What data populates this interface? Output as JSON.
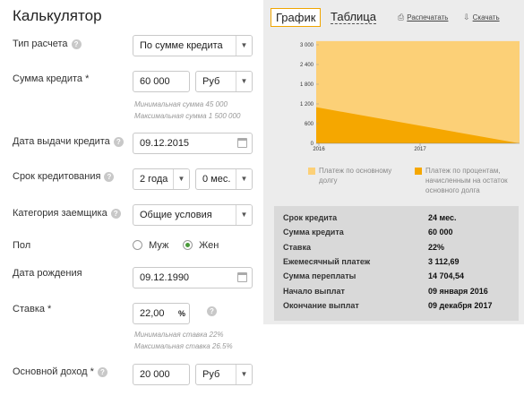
{
  "title": "Калькулятор",
  "form": {
    "loan_type": {
      "label": "Тип расчета",
      "value": "По сумме кредита"
    },
    "amount": {
      "label": "Сумма кредита *",
      "value": "60 000",
      "currency": "Руб",
      "hint_min": "Минимальная сумма 45 000",
      "hint_max": "Максимальная сумма 1 500 000"
    },
    "issue_date": {
      "label": "Дата выдачи кредита",
      "value": "09.12.2015"
    },
    "term": {
      "label": "Срок кредитования",
      "years": "2 года",
      "months": "0 мес."
    },
    "category": {
      "label": "Категория заемщика",
      "value": "Общие условия"
    },
    "gender": {
      "label": "Пол",
      "male": "Муж",
      "female": "Жен",
      "selected": "female"
    },
    "birth_date": {
      "label": "Дата рождения",
      "value": "09.12.1990"
    },
    "rate": {
      "label": "Ставка *",
      "value": "22,00",
      "unit": "%",
      "hint_min": "Минимальная ставка 22%",
      "hint_max": "Максимальная ставка 26.5%"
    },
    "income": {
      "label": "Основной доход *",
      "value": "20 000",
      "currency": "Руб"
    }
  },
  "tabs": {
    "graph": "График",
    "table": "Таблица",
    "print": "Распечатать",
    "download": "Скачать"
  },
  "chart_data": {
    "type": "area",
    "x_ticks": [
      "2016",
      "2017"
    ],
    "y_ticks": [
      "3 000",
      "2 400",
      "1 800",
      "1 200",
      "600",
      "0"
    ],
    "ylim": [
      0,
      3000
    ],
    "series": [
      {
        "name": "Платеж по основному долгу",
        "values": [
          3112.69,
          3112.69
        ],
        "color": "#fcd077"
      },
      {
        "name": "Платеж по процентам, начисленным на остаток основного долга",
        "values": [
          1100,
          0
        ],
        "color": "#f5a700"
      }
    ],
    "legend_placement": "bottom"
  },
  "summary": [
    {
      "key": "Срок кредита",
      "value": "24 мес."
    },
    {
      "key": "Сумма кредита",
      "value": "60 000"
    },
    {
      "key": "Ставка",
      "value": "22%"
    },
    {
      "key": "Ежемесячный платеж",
      "value": "3 112,69"
    },
    {
      "key": "Сумма переплаты",
      "value": "14 704,54"
    },
    {
      "key": "Начало выплат",
      "value": "09 января 2016"
    },
    {
      "key": "Окончание выплат",
      "value": "09 декабря 2017"
    }
  ]
}
